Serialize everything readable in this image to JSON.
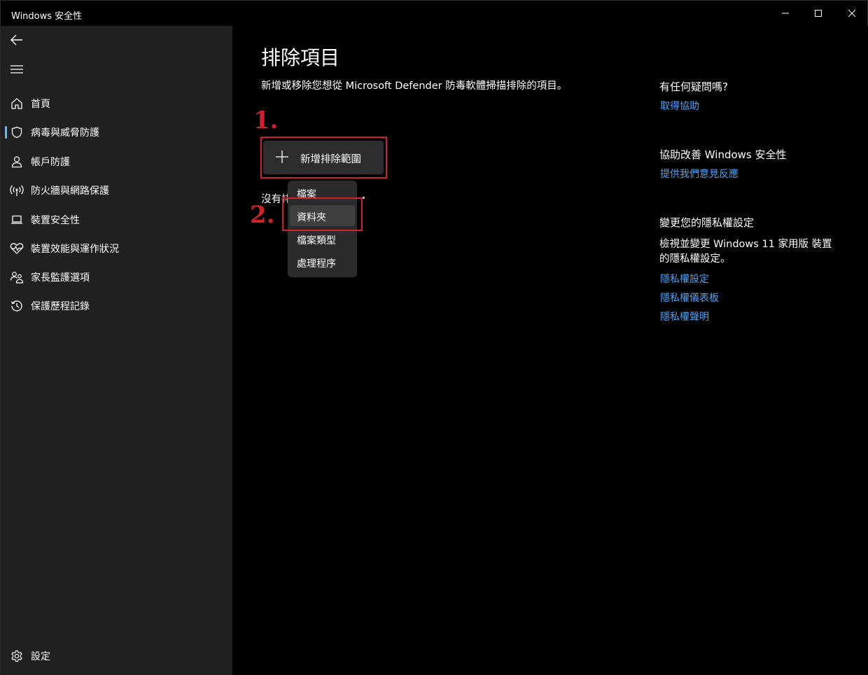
{
  "window": {
    "title": "Windows 安全性"
  },
  "sidebar": {
    "items": [
      {
        "label": "首頁",
        "icon": "home-icon"
      },
      {
        "label": "病毒與威脅防護",
        "icon": "shield-icon",
        "selected": true
      },
      {
        "label": "帳戶防護",
        "icon": "person-icon"
      },
      {
        "label": "防火牆與網路保護",
        "icon": "wireless-icon"
      },
      {
        "label": "裝置安全性",
        "icon": "laptop-icon"
      },
      {
        "label": "裝置效能與運作狀況",
        "icon": "heart-pulse-icon"
      },
      {
        "label": "家長監護選項",
        "icon": "family-icon"
      },
      {
        "label": "保護歷程記錄",
        "icon": "history-icon"
      }
    ],
    "settings_label": "設定"
  },
  "main": {
    "title": "排除項目",
    "description": "新增或移除您想從 Microsoft Defender 防毒軟體掃描排除的項目。",
    "add_button_label": "新增排除範圍",
    "no_items_text": "沒有排",
    "step1": "1.",
    "step2": "2.",
    "menu": {
      "items": [
        "檔案",
        "資料夾",
        "檔案類型",
        "處理程序"
      ],
      "selected": "資料夾"
    }
  },
  "right": {
    "help_heading": "有任何疑問嗎?",
    "help_link": "取得協助",
    "improve_heading": "協助改善 Windows 安全性",
    "improve_link": "提供我們意見反應",
    "privacy_heading": "變更您的隱私權設定",
    "privacy_text": "檢視並變更 Windows 11 家用版 裝置的隱私權設定。",
    "privacy_links": [
      "隱私權設定",
      "隱私權儀表板",
      "隱私權聲明"
    ]
  },
  "colors": {
    "accent": "#4cc2ff",
    "link": "#4aa3f5",
    "annotation": "#d0202a",
    "sidebar_bg": "#202020"
  }
}
